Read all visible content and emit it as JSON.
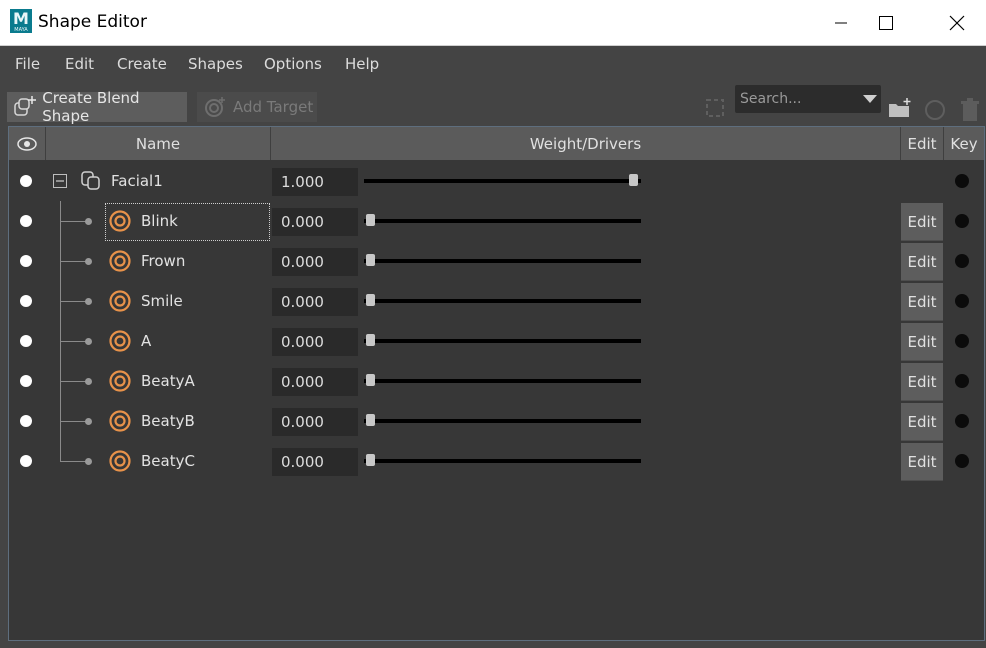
{
  "window": {
    "title": "Shape Editor",
    "logo_letter": "M",
    "logo_sub": "MAYA"
  },
  "menu": [
    "File",
    "Edit",
    "Create",
    "Shapes",
    "Options",
    "Help"
  ],
  "toolbar": {
    "create_blend_shape": "Create Blend Shape",
    "add_target": "Add Target",
    "search_placeholder": "Search..."
  },
  "columns": {
    "name": "Name",
    "weight_drivers": "Weight/Drivers",
    "edit": "Edit",
    "key": "Key"
  },
  "blend_shape": {
    "name": "Facial1",
    "weight": "1.000",
    "weight_value": 1.0
  },
  "targets": [
    {
      "name": "Blink",
      "weight": "0.000",
      "weight_value": 0.0,
      "edit_label": "Edit"
    },
    {
      "name": "Frown",
      "weight": "0.000",
      "weight_value": 0.0,
      "edit_label": "Edit"
    },
    {
      "name": "Smile",
      "weight": "0.000",
      "weight_value": 0.0,
      "edit_label": "Edit"
    },
    {
      "name": "A",
      "weight": "0.000",
      "weight_value": 0.0,
      "edit_label": "Edit"
    },
    {
      "name": "BeatyA",
      "weight": "0.000",
      "weight_value": 0.0,
      "edit_label": "Edit"
    },
    {
      "name": "BeatyB",
      "weight": "0.000",
      "weight_value": 0.0,
      "edit_label": "Edit"
    },
    {
      "name": "BeatyC",
      "weight": "0.000",
      "weight_value": 0.0,
      "edit_label": "Edit"
    }
  ],
  "colors": {
    "target_icon": "#e8924a",
    "selection_border": "#cfcfcf",
    "panel_border": "#5e6e7e"
  }
}
